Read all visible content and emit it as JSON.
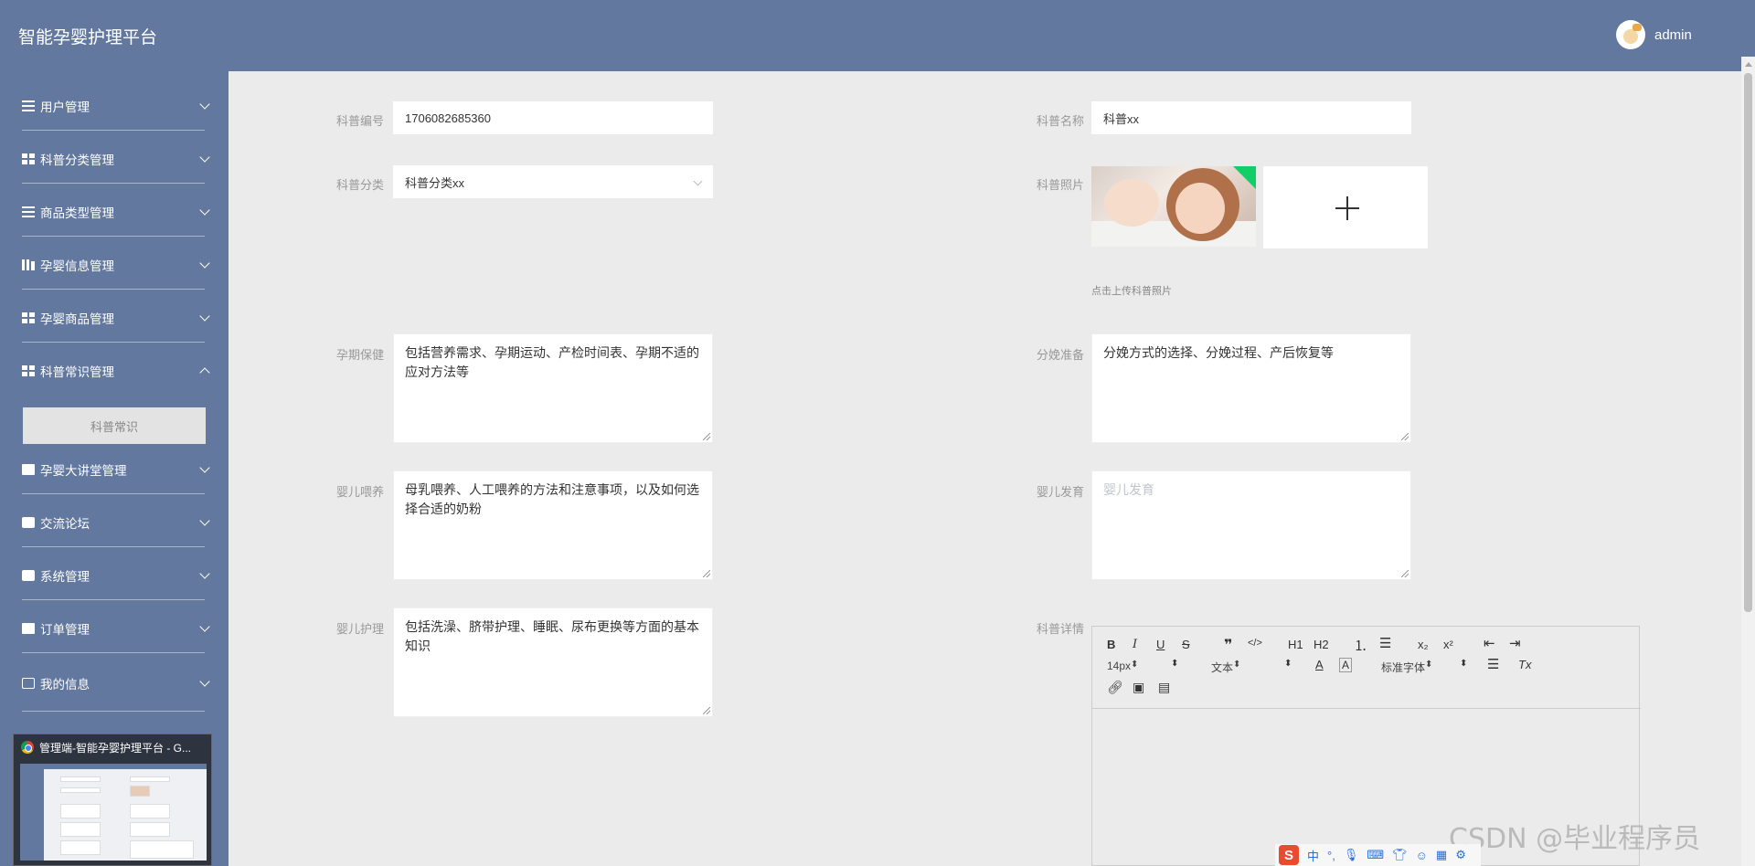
{
  "header": {
    "title": "智能孕婴护理平台",
    "username": "admin"
  },
  "sidebar": {
    "items": [
      {
        "label": "用户管理",
        "icon": "list-icon"
      },
      {
        "label": "科普分类管理",
        "icon": "grid-icon"
      },
      {
        "label": "商品类型管理",
        "icon": "list-icon"
      },
      {
        "label": "孕婴信息管理",
        "icon": "bars-icon"
      },
      {
        "label": "孕婴商品管理",
        "icon": "grid-icon"
      },
      {
        "label": "科普常识管理",
        "icon": "grid-icon",
        "expanded": true
      },
      {
        "label": "孕婴大讲堂管理",
        "icon": "clipboard-icon"
      },
      {
        "label": "交流论坛",
        "icon": "bag-icon"
      },
      {
        "label": "系统管理",
        "icon": "briefcase-icon"
      },
      {
        "label": "订单管理",
        "icon": "clipboard-icon"
      },
      {
        "label": "我的信息",
        "icon": "card-icon"
      }
    ],
    "active_sub_item": "科普常识"
  },
  "taskbar_preview": {
    "title": "管理端-智能孕婴护理平台 - G..."
  },
  "form": {
    "id": {
      "label": "科普编号",
      "value": "1706082685360"
    },
    "name": {
      "label": "科普名称",
      "value": "科普xx"
    },
    "category": {
      "label": "科普分类",
      "value": "科普分类xx"
    },
    "photo": {
      "label": "科普照片",
      "tip": "点击上传科普照片"
    },
    "pregnancy_care": {
      "label": "孕期保健",
      "value": "包括营养需求、孕期运动、产检时间表、孕期不适的应对方法等"
    },
    "delivery_prep": {
      "label": "分娩准备",
      "value": "分娩方式的选择、分娩过程、产后恢复等"
    },
    "infant_feeding": {
      "label": "婴儿喂养",
      "value": "母乳喂养、人工喂养的方法和注意事项，以及如何选择合适的奶粉"
    },
    "infant_development": {
      "label": "婴儿发育",
      "placeholder": "婴儿发育"
    },
    "infant_care": {
      "label": "婴儿护理",
      "value": "包括洗澡、脐带护理、睡眠、尿布更换等方面的基本知识"
    },
    "detail": {
      "label": "科普详情"
    }
  },
  "editor": {
    "font_size": "14px",
    "block_type": "文本",
    "font_family": "标准字体",
    "buttons": [
      "B",
      "I",
      "U",
      "S",
      "❞",
      "</>",
      "H1",
      "H2",
      "ordered-list",
      "bullet-list",
      "x₂",
      "x²",
      "outdent",
      "indent",
      "A",
      "highlight",
      "align",
      "Tx",
      "link",
      "image",
      "video"
    ]
  },
  "watermark": "CSDN @毕业程序员",
  "ime": {
    "mode": "中",
    "punct": "°,"
  }
}
